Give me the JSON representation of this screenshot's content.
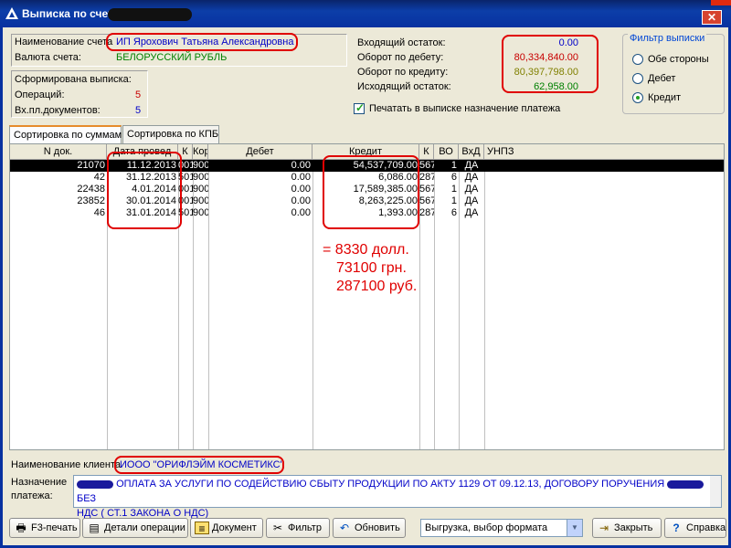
{
  "window": {
    "title": "Выписка по счету",
    "close_glyph": "✕"
  },
  "account": {
    "name_label": "Наименование счета",
    "name_value": "ИП Ярохович Татьяна Александровна",
    "currency_label": "Валюта счета:",
    "currency_value": "БЕЛОРУССКИЙ РУБЛЬ"
  },
  "stats": {
    "header": "Сформирована выписка:",
    "ops_label": "Операций:",
    "ops_value": "5",
    "docs_label": "Вх.пл.документов:",
    "docs_value": "5"
  },
  "balances": {
    "opening_label": "Входящий остаток:",
    "opening_value": "0.00",
    "debit_label": "Оборот по дебету:",
    "debit_value": "80,334,840.00",
    "credit_label": "Оборот по кредиту:",
    "credit_value": "80,397,798.00",
    "closing_label": "Исходящий остаток:",
    "closing_value": "62,958.00"
  },
  "filter": {
    "title": "Фильтр выписки",
    "options": [
      "Обе стороны",
      "Дебет",
      "Кредит"
    ],
    "selected": "Кредит"
  },
  "print_purpose": {
    "label": "Печатать в выписке назначение платежа",
    "checked": true
  },
  "tabs": [
    "Сортировка по суммам",
    "Сортировка по КПБ"
  ],
  "active_tab": "Сортировка по суммам",
  "table": {
    "columns": [
      "N док.",
      "Дата провед",
      "К",
      "Кор",
      "Дебет",
      "Кредит",
      "К",
      "ВО",
      "ВхД",
      "УНПЗ"
    ],
    "rows": [
      {
        "doc": "21070",
        "date": "11.12.2013",
        "k": "001",
        "kor": "900",
        "debit": "0.00",
        "credit": "54,537,709.00",
        "k2": "567",
        "vo": "1",
        "vhd": "ДА",
        "unpz": ""
      },
      {
        "doc": "42",
        "date": "31.12.2013",
        "k": "501",
        "kor": "900",
        "debit": "0.00",
        "credit": "6,086.00",
        "k2": "287",
        "vo": "6",
        "vhd": "ДА",
        "unpz": ""
      },
      {
        "doc": "22438",
        "date": "4.01.2014",
        "k": "001",
        "kor": "900",
        "debit": "0.00",
        "credit": "17,589,385.00",
        "k2": "567",
        "vo": "1",
        "vhd": "ДА",
        "unpz": ""
      },
      {
        "doc": "23852",
        "date": "30.01.2014",
        "k": "001",
        "kor": "900",
        "debit": "0.00",
        "credit": "8,263,225.00",
        "k2": "567",
        "vo": "1",
        "vhd": "ДА",
        "unpz": ""
      },
      {
        "doc": "46",
        "date": "31.01.2014",
        "k": "501",
        "kor": "900",
        "debit": "0.00",
        "credit": "1,393.00",
        "k2": "287",
        "vo": "6",
        "vhd": "ДА",
        "unpz": ""
      }
    ]
  },
  "annotation": {
    "line1": "= 8330 долл.",
    "line2": "73100 грн.",
    "line3": "287100 руб."
  },
  "client": {
    "label": "Наименование клиента",
    "value": "ИООО \"ОРИФЛЭЙМ КОСМЕТИКС\""
  },
  "purpose": {
    "label_line1": "Назначение",
    "label_line2": "платежа:",
    "text_part1": "ОПЛАТА ЗА УСЛУГИ ПО СОДЕЙСТВИЮ СБЫТУ ПРОДУКЦИИ ПО АКТУ 1129 ОТ 09.12.13, ДОГОВОРУ ПОРУЧЕНИЯ",
    "text_part2": "БЕЗ",
    "text_part3": "НДС ( СТ.1 ЗАКОНА О НДС)"
  },
  "toolbar": {
    "print": "F3-печать",
    "details": "Детали операции",
    "document": "Документ",
    "filter": "Фильтр",
    "refresh": "Обновить",
    "export_combo": "Выгрузка, выбор формата",
    "close": "Закрыть",
    "help": "Справка"
  },
  "colors": {
    "title_bar": "#0831a0",
    "highlight": "#e00000",
    "value_blue": "#0000c8",
    "value_red": "#c80000",
    "value_green": "#008000"
  }
}
